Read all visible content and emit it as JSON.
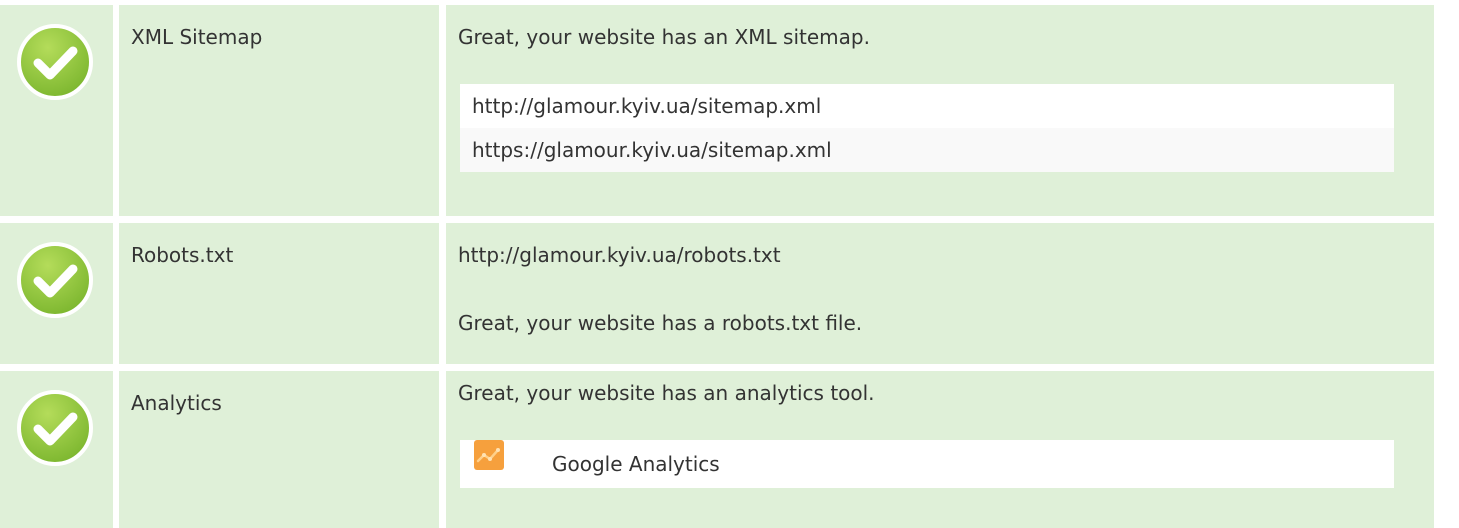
{
  "colors": {
    "row_bg": "#dff0d8",
    "check_green": "#8cc63f",
    "text": "#333333"
  },
  "rows": [
    {
      "icon": "check-circle-icon",
      "label": "XML Sitemap",
      "message": "Great, your website has an XML sitemap.",
      "items": [
        "http://glamour.kyiv.ua/sitemap.xml",
        "https://glamour.kyiv.ua/sitemap.xml"
      ]
    },
    {
      "icon": "check-circle-icon",
      "label": "Robots.txt",
      "url": "http://glamour.kyiv.ua/robots.txt",
      "message": "Great, your website has a robots.txt file."
    },
    {
      "icon": "check-circle-icon",
      "label": "Analytics",
      "message": "Great, your website has an analytics tool.",
      "tool": {
        "icon": "google-analytics-icon",
        "name": "Google Analytics"
      }
    }
  ]
}
